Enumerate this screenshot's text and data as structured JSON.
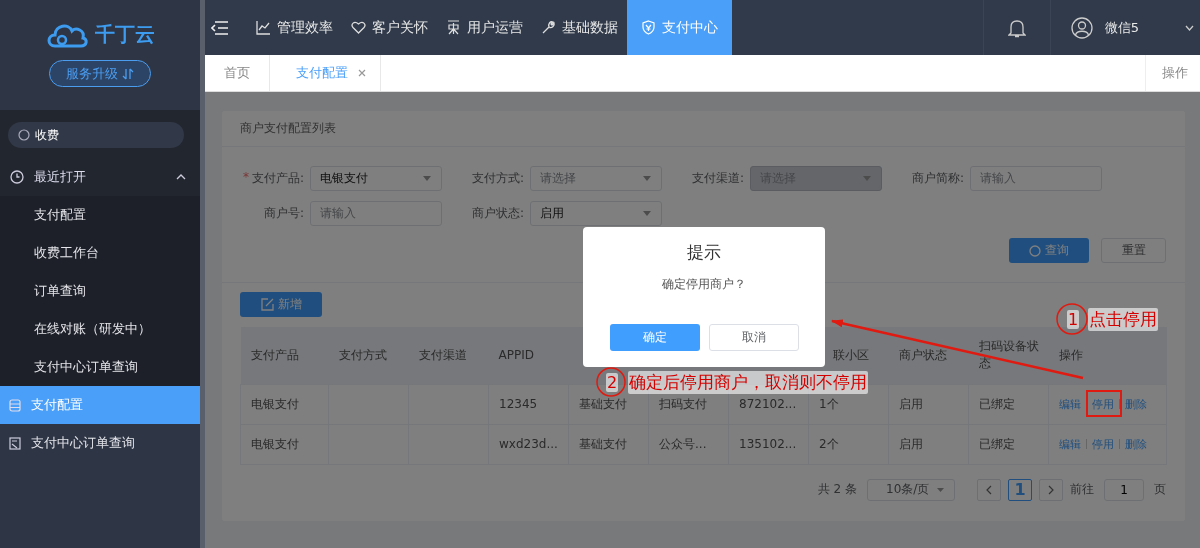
{
  "logo": {
    "text": "千丁云"
  },
  "upgrade_button": {
    "label": "服务升级"
  },
  "search": {
    "value": "收费"
  },
  "sidebar": {
    "sections": [
      {
        "label": "最近打开",
        "expanded": true,
        "children": [
          {
            "label": "支付配置"
          },
          {
            "label": "收费工作台"
          },
          {
            "label": "订单查询"
          },
          {
            "label": "在线对账（研发中）"
          },
          {
            "label": "支付中心订单查询"
          }
        ]
      }
    ],
    "items": [
      {
        "label": "支付配置",
        "selected": true,
        "kind": "config"
      },
      {
        "label": "支付中心订单查询",
        "selected": false,
        "kind": "report"
      }
    ]
  },
  "topnav": [
    {
      "label": "管理效率",
      "selected": false,
      "kind": "chart"
    },
    {
      "label": "客户关怀",
      "selected": false,
      "kind": "heart"
    },
    {
      "label": "用户运营",
      "selected": false,
      "kind": "user"
    },
    {
      "label": "基础数据",
      "selected": false,
      "kind": "wrench"
    },
    {
      "label": "支付中心",
      "selected": true,
      "kind": "shield"
    }
  ],
  "user": {
    "name": "微信5"
  },
  "tabs": [
    {
      "label": "首页",
      "selected": false,
      "closable": false
    },
    {
      "label": "支付配置",
      "selected": true,
      "closable": true
    }
  ],
  "tab_actions": {
    "label": "操作"
  },
  "card": {
    "title": "商户支付配置列表"
  },
  "filters": [
    {
      "kind": "select",
      "required_mark": "*",
      "label": "支付产品:",
      "value": "电银支付",
      "disabled": false
    },
    {
      "kind": "select",
      "label": "支付方式:",
      "placeholder": "请选择",
      "disabled": false
    },
    {
      "kind": "select",
      "label": "支付渠道:",
      "placeholder": "请选择",
      "disabled": true
    },
    {
      "kind": "input",
      "label": "商户简称:",
      "placeholder": "请输入",
      "disabled": false
    },
    {
      "kind": "input",
      "label": "商户号:",
      "placeholder": "请输入",
      "disabled": false
    },
    {
      "kind": "select",
      "label": "商户状态:",
      "value": "启用",
      "disabled": false
    }
  ],
  "search_button": {
    "label": "查询"
  },
  "reset_button": {
    "label": "重置"
  },
  "add_button": {
    "label": "新增"
  },
  "table": {
    "columns": [
      {
        "label": "支付产品"
      },
      {
        "label": "支付方式"
      },
      {
        "label": "支付渠道"
      },
      {
        "label": "APPID"
      },
      {},
      {},
      {},
      {
        "label": "联小区"
      },
      {
        "label": "商户状态"
      },
      {
        "label": "扫码设备状态"
      },
      {
        "label": "操作"
      }
    ],
    "rows": [
      {
        "cells": [
          "电银支付",
          null,
          null,
          "12345",
          "基础支付",
          "扫码支付",
          "872102...",
          "1个",
          "启用",
          "已绑定"
        ],
        "actions": [
          {
            "label": "编辑"
          },
          {
            "label": "停用"
          },
          {
            "label": "删除"
          }
        ]
      },
      {
        "cells": [
          "电银支付",
          null,
          null,
          "wxd23d...",
          "基础支付",
          "公众号...",
          "135102...",
          "2个",
          "启用",
          "已绑定"
        ],
        "actions": [
          {
            "label": "编辑"
          },
          {
            "label": "停用"
          },
          {
            "label": "删除"
          }
        ]
      }
    ]
  },
  "pagination": {
    "total": "共 2 条",
    "page_size": "10条/页",
    "pages": [
      {
        "label": "1",
        "selected": true
      }
    ],
    "goto_label": "前往",
    "goto_value": "1",
    "goto_suffix": "页"
  },
  "modal": {
    "title": "提示",
    "message": "确定停用商户？",
    "confirm": "确定",
    "cancel": "取消"
  },
  "annotations": [
    {
      "number": "1",
      "text": "点击停用"
    },
    {
      "number": "2",
      "text": "确定后停用商户，取消则不停用"
    }
  ]
}
